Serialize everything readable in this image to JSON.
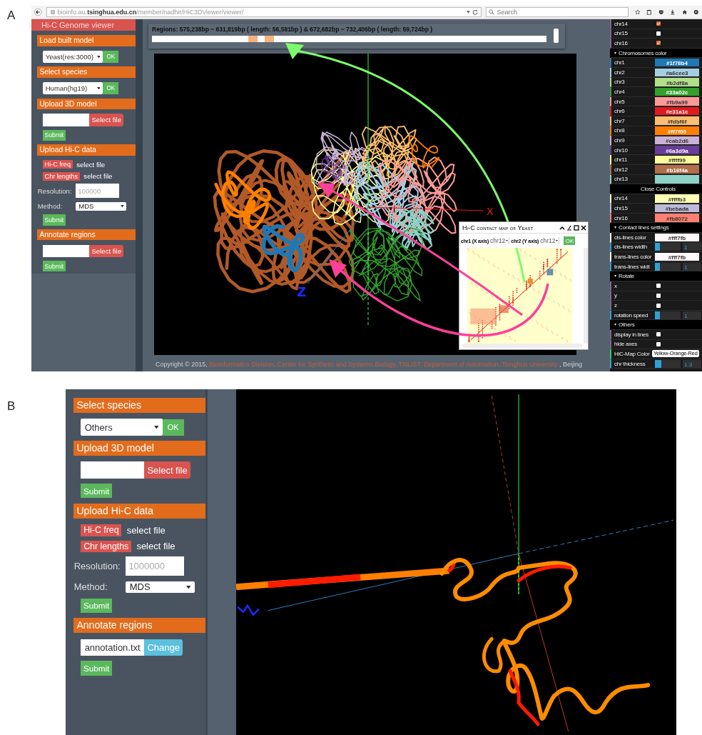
{
  "panel_a": {
    "label": "A",
    "browser": {
      "url": "bioinfo.au.**tsinghua.edu.cn**/member/nadhir/HiC3DViewer/viewer/",
      "search": {
        "placeholder": "Search"
      }
    },
    "sidebar": {
      "title": "Hi-C Genome viewer",
      "sections": [
        {
          "title": "Load built model",
          "items": [
            {
              "kind": "select",
              "value": "Yeast(res:3000)",
              "button": "OK"
            }
          ]
        },
        {
          "title": "Select species",
          "items": [
            {
              "kind": "select",
              "value": "Human(hg19)",
              "button": "OK"
            }
          ]
        },
        {
          "title": "Upload 3D model",
          "items": [
            {
              "kind": "file",
              "loaded": false,
              "button": "Select file"
            },
            {
              "kind": "submit",
              "label": "Submit"
            }
          ]
        },
        {
          "title": "Upload Hi-C data",
          "items": [
            {
              "kind": "upload",
              "button": "Hi-C freq",
              "text": "select file"
            },
            {
              "kind": "upload",
              "button": "Chr lengths",
              "text": "select file"
            },
            {
              "kind": "number",
              "label": "Resolution:",
              "placeholder": "100000"
            },
            {
              "kind": "dropdown",
              "label": "Method:",
              "value": "MDS"
            },
            {
              "kind": "submit",
              "label": "Submit"
            }
          ]
        },
        {
          "title": "Annotate regions",
          "items": [
            {
              "kind": "file",
              "loaded": false,
              "button": "Select file"
            },
            {
              "kind": "submit",
              "label": "Submit"
            }
          ]
        }
      ]
    },
    "regions": "Regions: 575,238bp ~ 631,819bp ( length: 56,581bp ) & 672,682bp ~ 732,406bp ( length: 59,724bp )",
    "axis_labels": {
      "x": "X",
      "z": "Z"
    },
    "contact_map": {
      "title": "Hi-C contact map of Yeast",
      "x_label": "chr1 (X axis)",
      "x_value": "chr12",
      "y_label": "chr2 (Y axis)",
      "y_value": "chr12",
      "button": "OK"
    },
    "footer": {
      "text": "Copyright © 2015, ",
      "link": "Bioinformatics Division, Center for Synthetic and Systems Biology, TNLIST, Department of Automation, Tsinghua University",
      "suffix": " , Beijing"
    },
    "controls": [
      {
        "kind": "checkbox",
        "label": "chr14",
        "checked": true
      },
      {
        "kind": "checkbox",
        "label": "chr15",
        "checked": false
      },
      {
        "kind": "checkbox",
        "label": "chr16",
        "checked": true
      },
      {
        "kind": "folder",
        "label": "Chromosomes color"
      },
      {
        "kind": "color",
        "label": "chr1",
        "color": "#1f78b4"
      },
      {
        "kind": "color",
        "label": "chr2",
        "color": "#a6cee3"
      },
      {
        "kind": "color",
        "label": "chr3",
        "color": "#b2df8a"
      },
      {
        "kind": "color",
        "label": "chr4",
        "color": "#33a02c"
      },
      {
        "kind": "color",
        "label": "chr5",
        "color": "#fb9a99"
      },
      {
        "kind": "color",
        "label": "chr6",
        "color": "#e31a1c"
      },
      {
        "kind": "color",
        "label": "chr7",
        "color": "#fdbf6f"
      },
      {
        "kind": "color",
        "label": "chr8",
        "color": "#ff7f00"
      },
      {
        "kind": "color",
        "label": "chr9",
        "color": "#cab2d6"
      },
      {
        "kind": "color",
        "label": "chr10",
        "color": "#6a3d9a"
      },
      {
        "kind": "color",
        "label": "chr11",
        "color": "#ffff99"
      },
      {
        "kind": "color",
        "label": "chr12",
        "color": "#b16f4a"
      },
      {
        "kind": "swatch",
        "label": "chr13",
        "color": "#8dd3c7"
      },
      {
        "kind": "close",
        "label": "Close Controls"
      },
      {
        "kind": "color",
        "label": "chr14",
        "color": "#ffffb3"
      },
      {
        "kind": "color",
        "label": "chr15",
        "color": "#bebada"
      },
      {
        "kind": "color",
        "label": "chr16",
        "color": "#fb8072"
      },
      {
        "kind": "folder",
        "label": "Contact lines settings"
      },
      {
        "kind": "color",
        "label": "cis-lines color",
        "color": "#fff7fb"
      },
      {
        "kind": "slider",
        "label": "cis-lines width",
        "level": 0.2,
        "reading": "1"
      },
      {
        "kind": "color",
        "label": "trans-lines color",
        "color": "#fff7fb"
      },
      {
        "kind": "slider",
        "label": "trans-lines widt",
        "level": 0.2,
        "reading": "1"
      },
      {
        "kind": "folder",
        "label": "Rotate"
      },
      {
        "kind": "checkbox",
        "label": "x",
        "checked": false
      },
      {
        "kind": "checkbox",
        "label": "y",
        "checked": false
      },
      {
        "kind": "checkbox",
        "label": "z",
        "checked": false
      },
      {
        "kind": "slider",
        "label": "rotation speed",
        "level": 0.2,
        "reading": "1"
      },
      {
        "kind": "folder",
        "label": "Others"
      },
      {
        "kind": "checkbox",
        "label": "display in lines",
        "checked": false
      },
      {
        "kind": "checkbox",
        "label": "hide axes",
        "checked": false
      },
      {
        "kind": "select",
        "label": "HiC-Map Color",
        "value": "Yellow-Orange-Red"
      },
      {
        "kind": "slider",
        "label": "chr thickness",
        "level": 0.25,
        "reading": "1.3"
      }
    ]
  },
  "panel_b": {
    "label": "B",
    "sidebar": {
      "sections": [
        {
          "title": "Select species",
          "items": [
            {
              "kind": "select",
              "value": "Others",
              "button": "OK"
            }
          ]
        },
        {
          "title": "Upload 3D model",
          "items": [
            {
              "kind": "file",
              "loaded": false,
              "button": "Select file"
            },
            {
              "kind": "submit",
              "label": "Submit"
            }
          ]
        },
        {
          "title": "Upload Hi-C data",
          "items": [
            {
              "kind": "upload",
              "button": "Hi-C freq",
              "text": "select file"
            },
            {
              "kind": "upload",
              "button": "Chr lengths",
              "text": "select file"
            },
            {
              "kind": "number",
              "label": "Resolution:",
              "placeholder": "1000000"
            },
            {
              "kind": "dropdown",
              "label": "Method:",
              "value": "MDS"
            },
            {
              "kind": "submit",
              "label": "Submit"
            }
          ]
        },
        {
          "title": "Annotate regions",
          "items": [
            {
              "kind": "file",
              "loaded": true,
              "value": "annotation.txt",
              "button": "Change"
            },
            {
              "kind": "submit",
              "label": "Submit"
            }
          ]
        }
      ]
    }
  }
}
